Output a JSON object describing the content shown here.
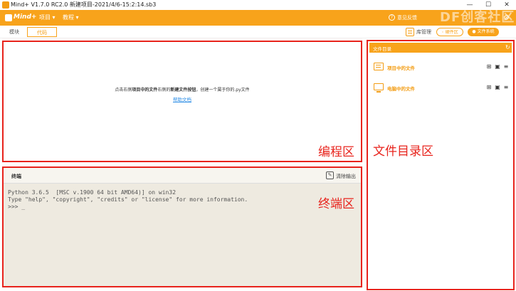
{
  "window": {
    "title": "Mind+ V1.7.0 RC2.0   新建项目-2021/4/6-15:2:14.sb3",
    "minimize": "—",
    "maximize": "☐",
    "close": "✕"
  },
  "menubar": {
    "logo_text": "Mind+",
    "items": [
      {
        "label": "项目 ▾"
      },
      {
        "label": "教程 ▾"
      }
    ],
    "right_text": "意见反馈",
    "watermark": "DF创客社区",
    "icons": {
      "help": "question-circle",
      "settings": "gear"
    }
  },
  "toolbar": {
    "tabs": [
      {
        "label": "模块"
      },
      {
        "label": "代码"
      }
    ],
    "active_tab": "代码",
    "library_label": "库管理",
    "hardware_label": "◦ 硬件区",
    "filesystem_label": "● 文件系统"
  },
  "editor": {
    "hint_prefix": "点击右侧",
    "hint_bold1": "项目中的文件",
    "hint_mid": "右侧的",
    "hint_bold2": "新建文件按钮",
    "hint_suffix": "，创建一个属于你的.py文件",
    "help_link": "帮助文档",
    "zone_label": "编程区"
  },
  "terminal": {
    "title": "终端",
    "clear_label": "清除输出",
    "lines": [
      "Python 3.6.5  [MSC v.1900 64 bit AMD64)] on win32",
      "Type \"help\", \"copyright\", \"credits\" or \"license\" for more information.",
      ">>> _"
    ],
    "zone_label": "终端区"
  },
  "files": {
    "title": "文件目录",
    "rows": [
      {
        "label": "项目中的文件"
      },
      {
        "label": "电脑中的文件"
      }
    ],
    "zone_label": "文件目录区"
  },
  "colors": {
    "accent": "#f8a31b",
    "annotation_red": "#e8231c",
    "link_blue": "#2d8ee6",
    "terminal_bg": "#eeeae0"
  }
}
